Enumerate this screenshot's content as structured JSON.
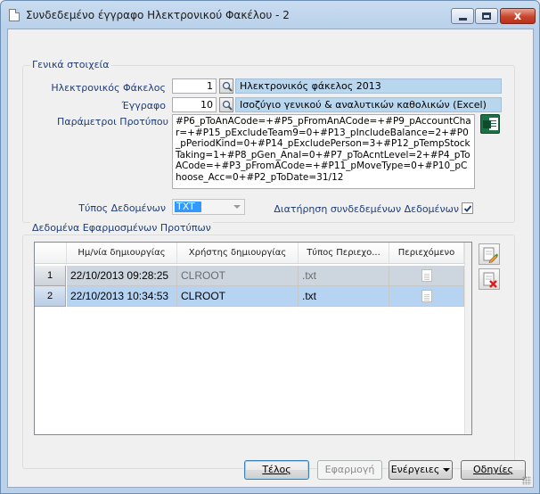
{
  "window": {
    "title": "Συνδεδεμένο έγγραφο Ηλεκτρονικού Φακέλου - 2",
    "close_symbol": "x"
  },
  "general": {
    "legend": "Γενικά στοιχεία",
    "folder": {
      "label": "Ηλεκτρονικός Φάκελος",
      "code": "1",
      "name": "Ηλεκτρονικός φάκελος 2013"
    },
    "document": {
      "label": "Έγγραφο",
      "code": "10",
      "name": "Ισοζύγιο γενικού & αναλυτικών καθολικών (Excel)"
    },
    "params": {
      "label": "Παράμετροι Προτύπου",
      "value": "#P6_pToAnACode=+#P5_pFromAnACode=+#P9_pAccountChar=+#P15_pExcludeTeam9=0+#P13_pIncludeBalance=2+#P0_pPeriodKind=0+#P14_pExcludePerson=3+#P12_pTempStockTaking=1+#P8_pGen_Anal=0+#P7_pToAcntLevel=2+#P4_pToACode=+#P3_pFromACode=+#P11_pMoveType=0+#P10_pChoose_Acc=0+#P2_pToDate=31/12"
    },
    "data_type": {
      "label": "Τύπος Δεδομένων",
      "value": "TXT"
    },
    "keep_linked": {
      "label": "Διατήρηση συνδεδεμένων Δεδομένων",
      "checked": true
    }
  },
  "applied": {
    "legend": "Δεδομένα Εφαρμοσμένων Προτύπων",
    "columns": [
      "Ημ/νία δημιουργίας",
      "Χρήστης δημιουργίας",
      "Τύπος Περιεχο...",
      "Περιεχόμενο"
    ],
    "rows": [
      {
        "num": "1",
        "date": "22/10/2013 09:28:25",
        "user": "CLROOT",
        "type": ".txt",
        "content_icon": "document-icon"
      },
      {
        "num": "2",
        "date": "22/10/2013 10:34:53",
        "user": "CLROOT",
        "type": ".txt",
        "content_icon": "document-icon"
      }
    ]
  },
  "buttons": {
    "ok": "Τέλος",
    "apply": "Εφαρμογή",
    "actions": "Ενέργειες",
    "guide": "Οδηγίες"
  },
  "colors": {
    "readonly_fill": "#b9d6ef",
    "selected_row": "#b6d3f1",
    "label_blue": "#1e3c78"
  }
}
